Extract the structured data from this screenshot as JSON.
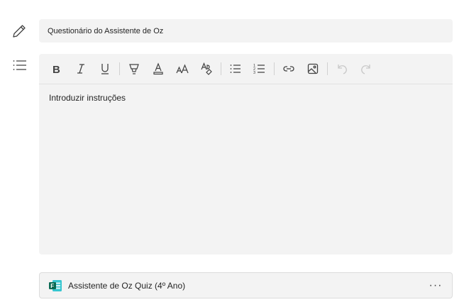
{
  "title_field": {
    "value": "Questionário do Assistente de Oz"
  },
  "editor": {
    "content": "Introduzir instruções"
  },
  "toolbar": {
    "icons": [
      "bold-icon",
      "italic-icon",
      "underline-icon",
      "highlight-icon",
      "font-color-icon",
      "font-size-icon",
      "clear-format-icon",
      "bullet-list-icon",
      "numbered-list-icon",
      "link-icon",
      "image-icon",
      "undo-icon",
      "redo-icon"
    ]
  },
  "attachment": {
    "label": "Assistente de Oz Quiz (4º Ano)",
    "more": "···"
  },
  "colors": {
    "field_bg": "#f3f3f3",
    "forms_green": "#0b6a53",
    "forms_teal": "#37c6d0"
  }
}
